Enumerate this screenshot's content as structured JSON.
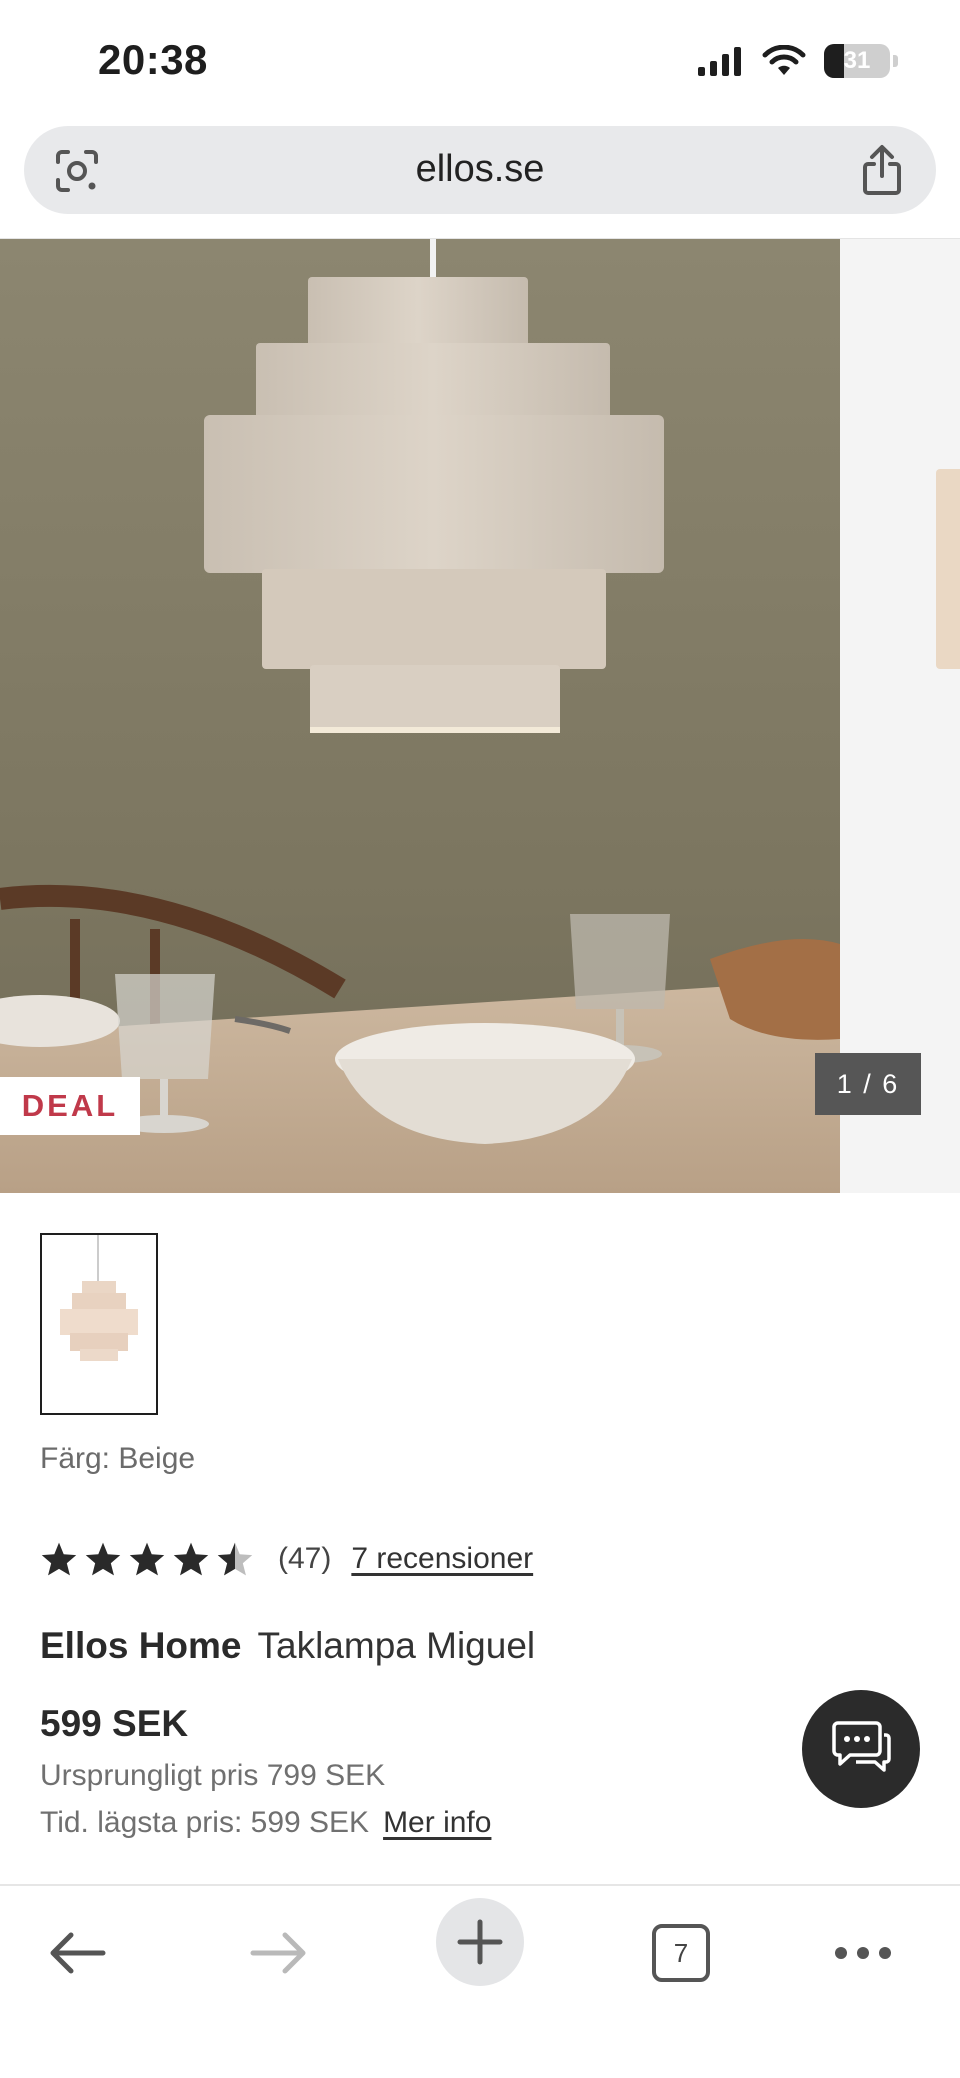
{
  "status_bar": {
    "time": "20:38",
    "battery": "31",
    "battery_level": 0.31
  },
  "browser": {
    "url": "ellos.se",
    "icons": {
      "lens": "camera-search-icon",
      "share": "share-icon"
    }
  },
  "gallery": {
    "deal_badge": "DEAL",
    "counter": "1 / 6",
    "image_alt": "Taklampa Miguel"
  },
  "product": {
    "color_label": "Färg: Beige",
    "rating": 4.5,
    "rating_count": "(47)",
    "reviews_link": "7 recensioner",
    "brand": "Ellos Home",
    "name": "Taklampa Miguel",
    "price": "599 SEK",
    "original_price": "Ursprungligt pris 799 SEK",
    "lowest_price": "Tid. lägsta pris: 599 SEK",
    "more_info": "Mer info"
  },
  "toolbar": {
    "tab_count": "7",
    "icons": [
      "back-arrow-icon",
      "forward-arrow-icon",
      "plus-icon",
      "tabs-icon",
      "more-icon"
    ]
  },
  "colors": {
    "deal": "#c0394a",
    "chat_button": "#2b2b2b",
    "url_bar": "#e8e9eb"
  }
}
